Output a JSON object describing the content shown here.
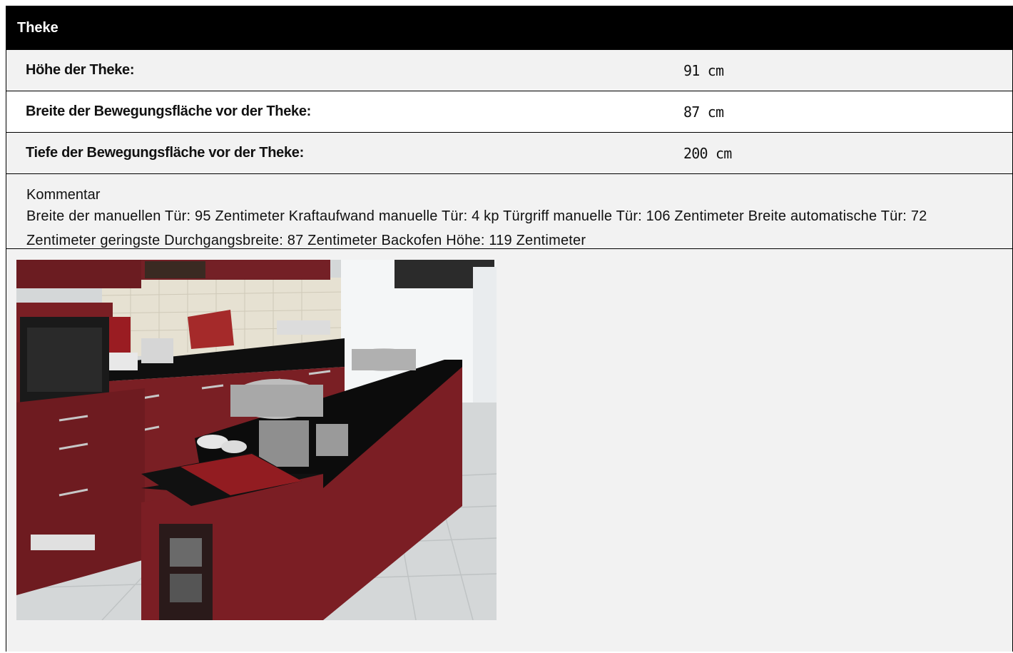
{
  "section": {
    "title": "Theke"
  },
  "rows": [
    {
      "label": "Höhe der Theke:",
      "value": "91 cm"
    },
    {
      "label": "Breite der Bewegungsfläche vor der Theke:",
      "value": "87 cm"
    },
    {
      "label": "Tiefe der Bewegungsfläche vor der Theke:",
      "value": "200 cm"
    }
  ],
  "comment": {
    "title": "Kommentar",
    "text": "Breite der manuellen Tür: 95 Zentimeter Kraftaufwand manuelle Tür: 4 kp Türgriff manuelle Tür: 106 Zentimeter Breite automatische Tür: 72 Zentimeter geringste Durchgangsbreite: 87 Zentimeter Backofen Höhe: 119 Zentimeter"
  },
  "photo": {
    "subject": "kitchen-counter-photo",
    "colors": {
      "cabinet": "#7a1f24",
      "counter": "#111111",
      "tile": "#d9dcdc",
      "wall_tile": "#e8e4d8"
    }
  }
}
